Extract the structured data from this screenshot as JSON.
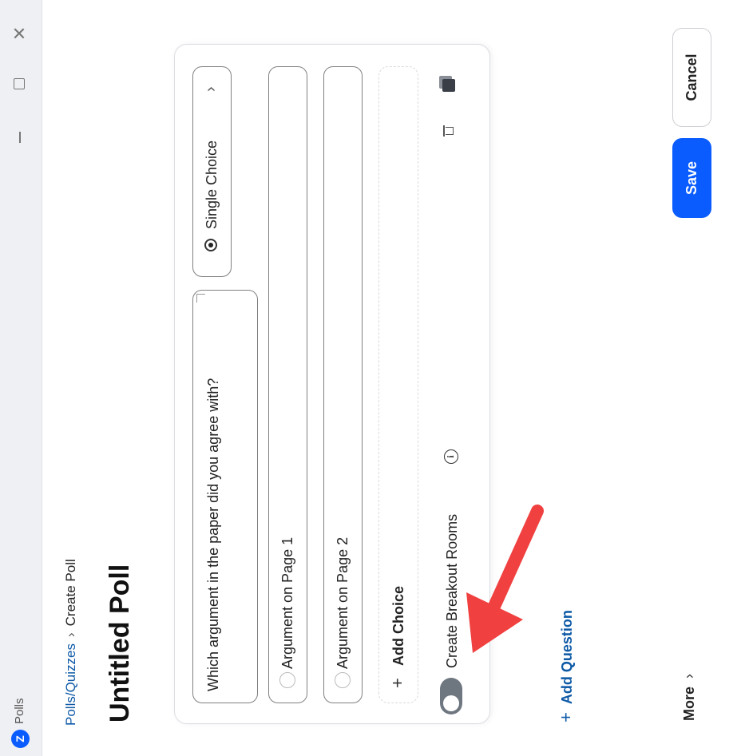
{
  "window": {
    "title": "Polls",
    "logo_letter": "Z",
    "minimize_glyph": "—",
    "close_glyph": "✕"
  },
  "breadcrumb": {
    "parent": "Polls/Quizzes",
    "separator": "›",
    "current": "Create Poll"
  },
  "page_title": "Untitled Poll",
  "question": {
    "text": "Which argument in the paper did you agree with?",
    "type_label": "Single Choice",
    "type_chevron": "›",
    "choices": [
      {
        "label": "Argument on Page 1"
      },
      {
        "label": "Argument on Page 2"
      }
    ],
    "add_choice_plus": "+",
    "add_choice_label": "Add Choice"
  },
  "breakout": {
    "label": "Create Breakout Rooms",
    "info_glyph": "i",
    "toggle_on": false
  },
  "add_question": {
    "plus": "+",
    "label": "Add Question"
  },
  "more": {
    "label": "More",
    "chevron": "›"
  },
  "buttons": {
    "save": "Save",
    "cancel": "Cancel"
  },
  "colors": {
    "primary": "#0b5cff",
    "link": "#0e5aa7",
    "annotation_arrow": "#f04040"
  },
  "icons": [
    "zoom-logo-icon",
    "minimize-icon",
    "maximize-icon",
    "close-icon",
    "radio-icon",
    "chevron-right-icon",
    "plus-icon",
    "info-icon",
    "delete-icon",
    "duplicate-icon",
    "arrow-annotation"
  ]
}
